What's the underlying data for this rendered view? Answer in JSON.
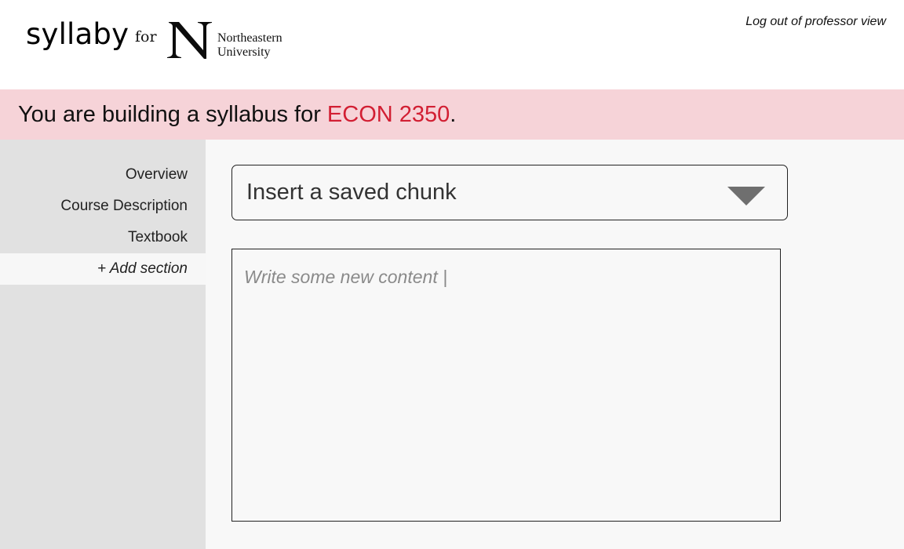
{
  "header": {
    "brand": "syllaby",
    "for_label": "for",
    "partner_logo_text": [
      "Northeastern",
      "University"
    ],
    "logout_label": "Log out of professor view"
  },
  "banner": {
    "prefix": "You are building a syllabus for ",
    "course": "ECON 2350",
    "suffix": ".",
    "background_color": "#f6d3d8",
    "course_color": "#d21f33"
  },
  "sidebar": {
    "items": [
      {
        "label": "Overview"
      },
      {
        "label": "Course Description"
      },
      {
        "label": "Textbook"
      },
      {
        "label": "+ Add section"
      }
    ]
  },
  "main": {
    "chunk_select": {
      "label": "Insert a saved chunk",
      "icon": "caret-down-icon"
    },
    "editor": {
      "placeholder": "Write some new content |"
    }
  }
}
